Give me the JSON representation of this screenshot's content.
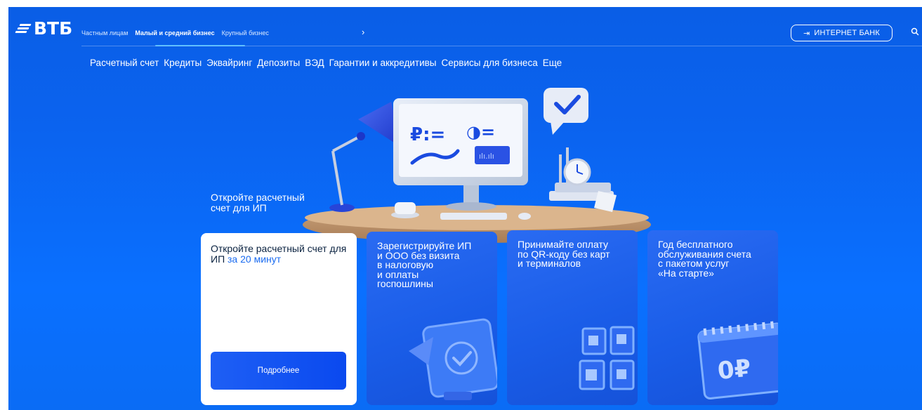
{
  "logo": {
    "text": "ВТБ"
  },
  "segments": [
    {
      "label": "Частным лицам",
      "active": false
    },
    {
      "label": "Малый и средний бизнес",
      "active": true
    },
    {
      "label": "Крупный бизнес",
      "active": false
    }
  ],
  "segments_more_icon": "chevron-right-icon",
  "internet_bank": {
    "label": "ИНТЕРНЕТ БАНК",
    "icon": "login-arrow-icon"
  },
  "search_icon": "search-icon",
  "nav": [
    "Расчетный счет",
    "Кредиты",
    "Эквайринг",
    "Депозиты",
    "ВЭД",
    "Гарантии и аккредитивы",
    "Сервисы для бизнеса",
    "Еще"
  ],
  "hero": {
    "title_line1": "Откройте расчетный",
    "title_line2": "счет для ИП",
    "illustration_text": {
      "ruble_list": "₽:=",
      "circle_list": "◑=",
      "chart_label": "ılı.ılı"
    }
  },
  "cards": {
    "main": {
      "title_part1": "Откройте расчетный счет для ИП",
      "title_highlight": "за 20 минут",
      "button": "Подробнее"
    },
    "register": {
      "lines": [
        "Зарегистрируйте ИП",
        "и ООО без визита",
        "в налоговую",
        "и оплаты",
        "госпошлины"
      ]
    },
    "qr": {
      "lines": [
        "Принимайте оплату",
        "по QR-коду без карт",
        "и терминалов"
      ]
    },
    "free": {
      "lines": [
        "Год бесплатного",
        "обслуживания счета",
        "с пакетом услуг",
        "«На старте»"
      ],
      "badge": "0₽"
    }
  },
  "colors": {
    "background": "#0a6cf5",
    "accent_light": "#49b6ff",
    "white_card": "#ffffff",
    "card_title_dark": "#0a2240",
    "highlight": "#1a6bf0",
    "button": "#0a49ef"
  }
}
